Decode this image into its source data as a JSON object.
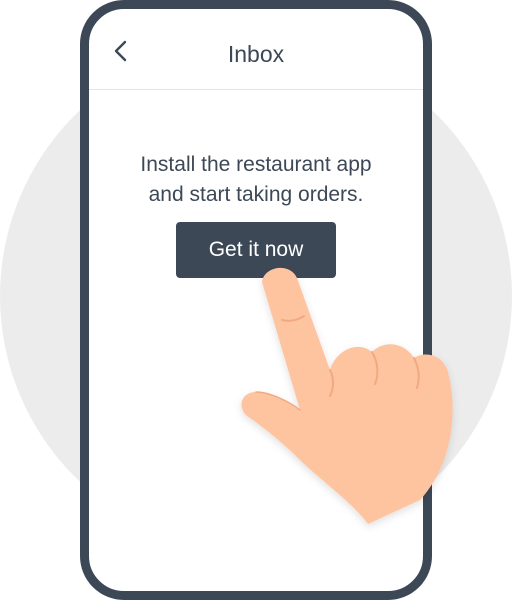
{
  "header": {
    "back_icon": "chevron-left-icon",
    "title": "Inbox"
  },
  "main": {
    "message_line1": "Install the restaurant app",
    "message_line2": "and start taking orders.",
    "cta_label": "Get it now"
  },
  "colors": {
    "phone_frame": "#3d4856",
    "background_circle": "#ececec",
    "button_bg": "#3d4856",
    "button_text": "#ffffff",
    "hand_skin": "#fec4a0"
  }
}
